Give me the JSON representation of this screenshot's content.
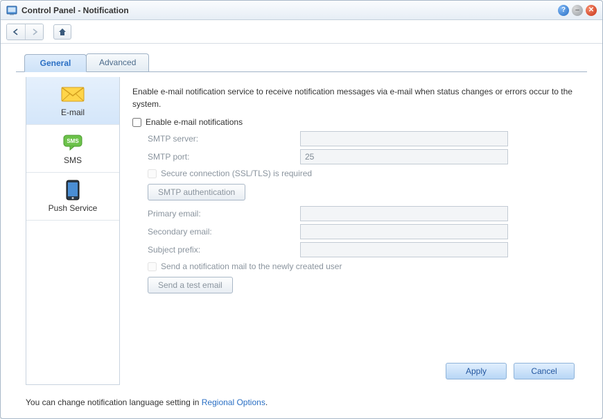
{
  "window": {
    "title": "Control Panel - Notification"
  },
  "tabs": [
    {
      "label": "General"
    },
    {
      "label": "Advanced"
    }
  ],
  "sidebar": {
    "items": [
      {
        "label": "E-mail"
      },
      {
        "label": "SMS"
      },
      {
        "label": "Push Service"
      }
    ]
  },
  "main": {
    "description": "Enable e-mail notification service to receive notification messages via e-mail when status changes or errors occur to the system.",
    "enable_email_label": "Enable e-mail notifications",
    "smtp_server_label": "SMTP server:",
    "smtp_server_value": "",
    "smtp_port_label": "SMTP port:",
    "smtp_port_value": "25",
    "ssl_label": "Secure connection (SSL/TLS) is required",
    "smtp_auth_button": "SMTP authentication",
    "primary_email_label": "Primary email:",
    "primary_email_value": "",
    "secondary_email_label": "Secondary email:",
    "secondary_email_value": "",
    "subject_prefix_label": "Subject prefix:",
    "subject_prefix_value": "",
    "send_new_user_label": "Send a notification mail to the newly created user",
    "test_email_button": "Send a test email",
    "apply_button": "Apply",
    "cancel_button": "Cancel"
  },
  "footer": {
    "note_prefix": "You can change notification language setting in ",
    "link_text": "Regional Options",
    "note_suffix": "."
  }
}
